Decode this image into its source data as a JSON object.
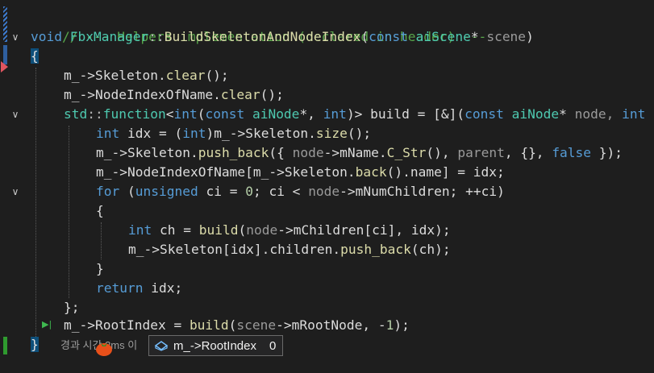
{
  "editor": {
    "comment": "// --- Helpers implementation (declared in header) ---",
    "fn_sig": {
      "ret": "void",
      "cls": "FbxManager",
      "sep": "::",
      "name": "BuildSkeletonAndNodeIndex",
      "open": "(",
      "const": "const",
      "type": "aiScene",
      "star": "*",
      "param": " scene",
      "close": ")"
    },
    "open_brace": "{",
    "close_brace": "}",
    "l3": {
      "a": "m_->Skeleton.",
      "fn": "clear",
      "b": "();"
    },
    "l4": {
      "a": "m_->NodeIndexOfName.",
      "fn": "clear",
      "b": "();"
    },
    "l5": {
      "std": "std",
      "sep": "::",
      "fn": "function",
      "lt": "<",
      "int1": "int",
      "p1": "(",
      "const": "const",
      "type": "aiNode",
      "star": "*, ",
      "int2": "int",
      "p2": ")>",
      "build": " build",
      "eq": " = [&](",
      "const2": "const",
      "type2": "aiNode",
      "star2": "*",
      "node": " node, ",
      "int3": "int"
    },
    "l6": {
      "int": "int",
      "idx": " idx = (",
      "int2": "int",
      "rest": ")m_->Skeleton.",
      "fn": "size",
      "end": "();"
    },
    "l7": {
      "a": "m_->Skeleton.",
      "fn": "push_back",
      "b": "({ ",
      "node": "node",
      "c": "->mName.",
      "fn2": "C_Str",
      "d": "(), ",
      "parent": "parent",
      "e": ", {}, ",
      "false": "false",
      "f": " });"
    },
    "l8": {
      "a": "m_->NodeIndexOfName[m_->Skeleton.",
      "fn": "back",
      "b": "().name] = idx;"
    },
    "l9": {
      "for": "for",
      "a": " (",
      "unsigned": "unsigned",
      "b": " ci = ",
      "zero": "0",
      "c": "; ci < ",
      "node": "node",
      "d": "->mNumChildren; ++ci)"
    },
    "l10": {
      "brace": "{"
    },
    "l11": {
      "int": "int",
      "a": " ch = ",
      "fn": "build",
      "b": "(",
      "node": "node",
      "c": "->mChildren[ci], idx);"
    },
    "l12": {
      "a": "m_->Skeleton[idx].children.",
      "fn": "push_back",
      "b": "(ch);"
    },
    "l13": {
      "brace": "}"
    },
    "l14": {
      "ret": "return",
      "a": " idx;"
    },
    "l15": {
      "a": "};"
    },
    "l16": {
      "a": "m_->RootIndex = ",
      "fn": "build",
      "b": "(",
      "scene": "scene",
      "c": "->mRootNode, -",
      "one": "1",
      "d": ");"
    }
  },
  "inline_hint": {
    "text": "경과 시간 3ms 이"
  },
  "datatip": {
    "expr": "m_->RootIndex",
    "value": "0",
    "icon": "watch-icon"
  },
  "colors": {
    "keyword": "#569cd6",
    "type": "#4ec9b0",
    "function": "#dcdcaa",
    "comment": "#57a64a",
    "param": "#9a9a9a",
    "number": "#b5cea8",
    "changed_marker": "#2f9a2f",
    "breakpoint": "#e05560"
  }
}
